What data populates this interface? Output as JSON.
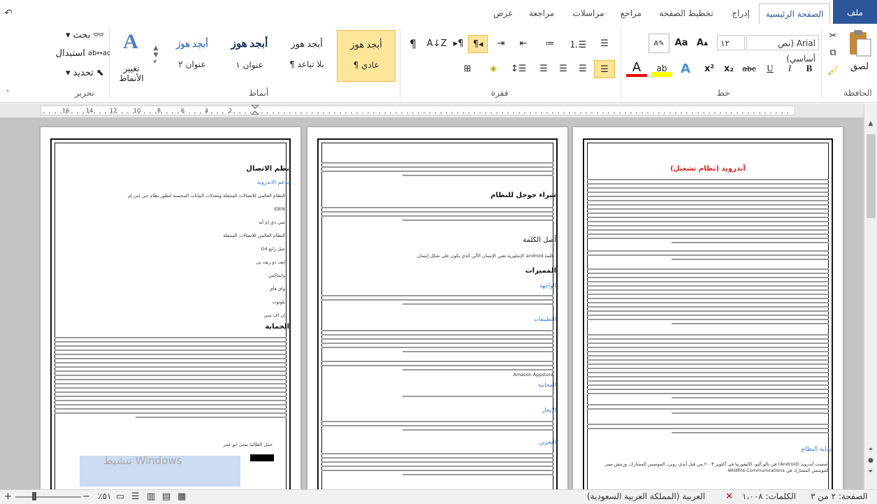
{
  "tabs": {
    "file": "ملف",
    "home": "الصفحة الرئيسية",
    "insert": "إدراج",
    "layout": "تخطيط الصفحة",
    "references": "مراجع",
    "mailings": "مراسلات",
    "review": "مراجعة",
    "view": "عرض"
  },
  "quick_access": {
    "undo": "↶"
  },
  "clipboard": {
    "paste": "لصق",
    "label": "الحافظة"
  },
  "font": {
    "name": "Arial (نص أساسي)",
    "size": "١٢",
    "label": "خط",
    "bold": "B",
    "italic": "I",
    "underline": "U",
    "strike": "abc",
    "subscript": "x₂",
    "superscript": "x²"
  },
  "paragraph": {
    "label": "فقرة"
  },
  "styles": {
    "label": "أنماط",
    "items": [
      {
        "preview": "أبجد هوز",
        "name": "¶ عادي"
      },
      {
        "preview": "أبجد هوز",
        "name": "¶ بلا تباعد"
      },
      {
        "preview": "أبجد هوز",
        "name": "عنوان ١"
      },
      {
        "preview": "أبجد هوز",
        "name": "عنوان ٢"
      }
    ],
    "change": "تغيير الأنماط"
  },
  "editing": {
    "label": "تحرير",
    "find": "بحث",
    "replace": "استبدال",
    "select": "تحديد"
  },
  "ruler": {
    "marks": [
      "16",
      "14",
      "12",
      "10",
      "8",
      "6",
      "4",
      "2"
    ]
  },
  "pages": {
    "right": {
      "title": "آندرويد (نظام تشغيل)",
      "section": "بداية النظام",
      "footer_line": "أسست آندرويد (Android) في بالو آلتو، كاليفورنيا في أكتوبر ٢٠٠٣ من قبل آندي روبن، الموسس المشارك، وريتش مينر الموسس المشارك في Wildfire Communications"
    },
    "middle": {
      "h1": "شراء جوجل للنظام",
      "h2": "أصل الكلمة",
      "h3": "المميزات",
      "sub1": "الواجهة",
      "sub2": "التطبيقات",
      "sub3": "المجانية",
      "sub4": "الإنجاز",
      "sub5": "التخزين",
      "word_origin": "كلمة android الإنجليزية تعني الإنسان الآلي الذي يكون على شكل إنسان",
      "apps_note": "Amazon Appstore"
    },
    "left": {
      "h1": "نظم الاتصال",
      "sub1": "يدعم الاندرويد",
      "items": [
        "النظام العالمي للاتصالات المتنقلة ومعدلات البيانات المحسنة لتطور نظام جي إس إم",
        "IDEN",
        "سي دي إم أيه",
        "النظام العالمي للاتصالات المتنقلة",
        "جيل رابع G4",
        "إيف دو ريف بي",
        "وايماكس",
        "واي فاي",
        "بلوتوث",
        "إن اف سي"
      ],
      "h2": "الحماية",
      "signature": "عمل الطالبة يمنى ابو عمر",
      "watermark": "تنشيط Windows"
    }
  },
  "status": {
    "page": "الصفحة: ٢ من ٣",
    "words": "الكلمات: ١،٠٠٨",
    "language": "العربية (المملكة العربية السعودية)",
    "zoom": "٥١٪"
  }
}
